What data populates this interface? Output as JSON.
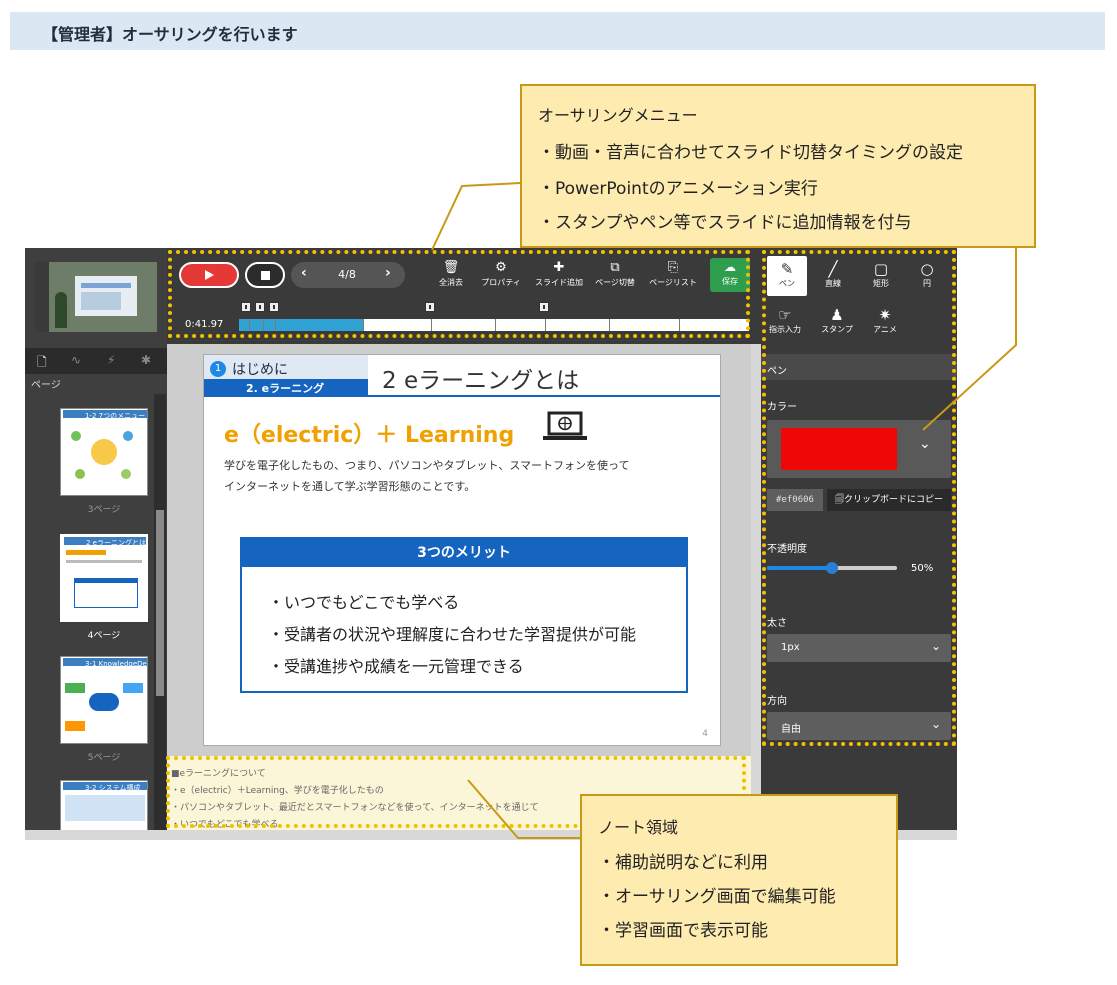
{
  "header": {
    "title": "【管理者】オーサリングを行います"
  },
  "left_panel": {
    "tabs": [
      "🗋",
      "∿",
      "⚡",
      "✱"
    ],
    "tab_label": "ページ",
    "thumbnails": [
      {
        "title": "1-2 7つのメニュー",
        "caption": "3ページ"
      },
      {
        "title": "2 eラーニングとは",
        "caption": "4ページ"
      },
      {
        "title": "3-1 KnowledgeDeliverとは",
        "caption": "5ページ"
      },
      {
        "title": "3-2 システム構成",
        "caption": ""
      }
    ]
  },
  "toolbar": {
    "page_indicator": "4/8",
    "tools": [
      {
        "icon": "🗑",
        "label": "全消去"
      },
      {
        "icon": "⚙",
        "label": "プロパティ"
      },
      {
        "icon": "✚",
        "label": "スライド追加"
      },
      {
        "icon": "⧉",
        "label": "ページ切替"
      },
      {
        "icon": "⎘",
        "label": "ページリスト"
      }
    ],
    "save_label": "保存",
    "time": "0:41.97",
    "progress": 0.245
  },
  "slide": {
    "chapter_number": "1",
    "chapter": "はじめに",
    "section": "2. eラーニング",
    "title": "2 eラーニングとは",
    "headline": "e（electric）＋  Learning",
    "body_line1": "学びを電子化したもの、つまり、パソコンやタブレット、スマートフォンを使って",
    "body_line2": "インターネットを通して学ぶ学習形態のことです。",
    "merit_title": "3つのメリット",
    "merits": [
      "・いつでもどこでも学べる",
      "・受講者の状況や理解度に合わせた学習提供が可能",
      "・受講進捗や成績を一元管理できる"
    ],
    "page_number": "4"
  },
  "notes": {
    "lines": [
      "■eラーニングについて",
      "・e（electric）＋Learning、学びを電子化したもの",
      "・パソコンやタブレット、最近だとスマートフォンなどを使って、インターネットを通じて",
      "・いつでもどこでも学べる"
    ]
  },
  "right_panel": {
    "tools_row1": [
      {
        "icon": "✎",
        "label": "ペン"
      },
      {
        "icon": "╱",
        "label": "直線"
      },
      {
        "icon": "▢",
        "label": "矩形"
      },
      {
        "icon": "○",
        "label": "円"
      }
    ],
    "tools_row2": [
      {
        "icon": "☞",
        "label": "指示入力"
      },
      {
        "icon": "♟",
        "label": "スタンプ"
      },
      {
        "icon": "✷",
        "label": "アニメ"
      }
    ],
    "section_title": "ペン",
    "color_label": "カラー",
    "color_value": "#ef0606",
    "hex_text": "#ef0606",
    "copy_label": "🗐クリップボードにコピー",
    "opacity_label": "不透明度",
    "opacity_value": "50%",
    "opacity": 0.5,
    "width_label": "太さ",
    "width_value": "1px",
    "direction_label": "方向",
    "direction_value": "自由"
  },
  "callouts": {
    "authoring": {
      "title": "オーサリングメニュー",
      "items": [
        "・動画・音声に合わせてスライド切替タイミングの設定",
        "・PowerPointのアニメーション実行",
        "・スタンプやペン等でスライドに追加情報を付与"
      ]
    },
    "notes": {
      "title": "ノート領域",
      "items": [
        "・補助説明などに利用",
        "・オーサリング画面で編集可能",
        "・学習画面で表示可能"
      ]
    }
  },
  "colors": {
    "accent_blue": "#1565c0",
    "highlight_yellow": "#f3c000",
    "callout_bg": "#fdebb0",
    "save_green": "#2e9e4e",
    "play_red": "#e53935"
  }
}
